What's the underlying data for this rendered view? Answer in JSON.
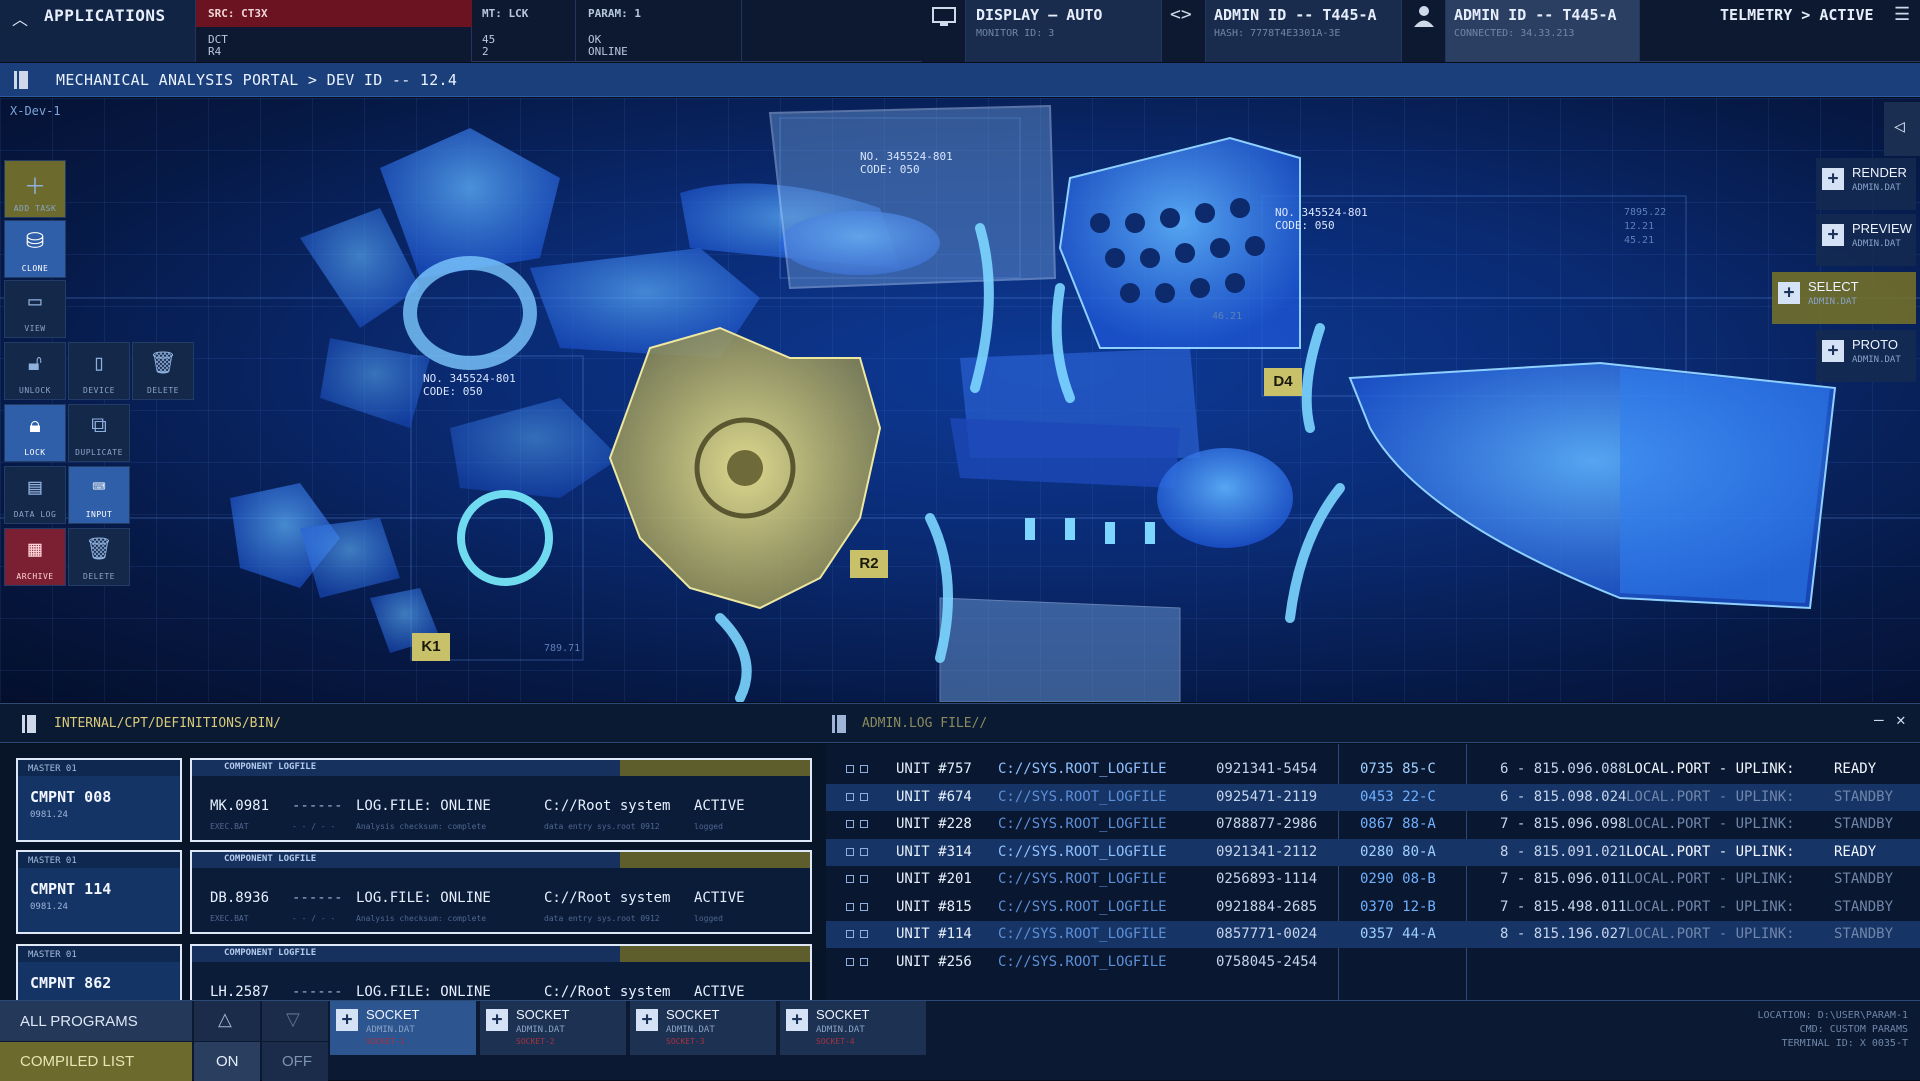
{
  "topbar": {
    "apps_label": "APPLICATIONS",
    "src": {
      "title": "SRC: CT3X",
      "line1": "DCT",
      "line2": "R4"
    },
    "mt": {
      "title": "MT: LCK",
      "line1": "45",
      "line2": "2"
    },
    "param": {
      "title": "PARAM: 1",
      "line1": "OK",
      "line2": "ONLINE"
    },
    "display": {
      "title": "DISPLAY – AUTO",
      "sub": "MONITOR ID: 3"
    },
    "admin1": {
      "title": "ADMIN ID -- T445-A",
      "sub": "HASH: 7778T4E3301A-3E"
    },
    "admin2": {
      "title": "ADMIN ID -- T445-A",
      "sub": "CONNECTED: 34.33.213"
    },
    "telemetry": "TELMETRY > ACTIVE"
  },
  "breadcrumb": "MECHANICAL ANALYSIS PORTAL > DEV ID -- 12.4",
  "viewport": {
    "device_label": "X-Dev-1",
    "annotations": [
      {
        "line1": "NO. 345524-801",
        "line2": "CODE: 050"
      },
      {
        "line1": "NO. 345524-801",
        "line2": "CODE: 050"
      },
      {
        "line1": "NO. 345524-801",
        "line2": "CODE: 050"
      }
    ],
    "tags": {
      "k1": "K1",
      "r2": "R2",
      "d4": "D4"
    },
    "small_nums": {
      "a": "789.71",
      "b": "7895.22",
      "c": "12.21",
      "d": "45.21",
      "e": "46.21"
    }
  },
  "toolbar": [
    {
      "label": "ADD TASK",
      "icon": "plus-icon"
    },
    {
      "label": "CLONE",
      "icon": "database-icon"
    },
    {
      "label": "VIEW",
      "icon": "monitor-icon"
    },
    {
      "label": "UNLOCK",
      "icon": "unlock-icon"
    },
    {
      "label": "DEVICE",
      "icon": "phone-icon"
    },
    {
      "label": "DELETE",
      "icon": "trash-icon"
    },
    {
      "label": "LOCK",
      "icon": "lock-icon"
    },
    {
      "label": "DUPLICATE",
      "icon": "duplicate-icon"
    },
    {
      "label": "DATA LOG",
      "icon": "archive-icon"
    },
    {
      "label": "INPUT",
      "icon": "keyboard-icon"
    },
    {
      "label": "ARCHIVE",
      "icon": "archive-box-icon"
    },
    {
      "label": "DELETE",
      "icon": "trash-icon"
    }
  ],
  "right_actions": [
    {
      "name": "RENDER",
      "sub": "ADMIN.DAT"
    },
    {
      "name": "PREVIEW",
      "sub": "ADMIN.DAT"
    },
    {
      "name": "SELECT",
      "sub": "ADMIN.DAT"
    },
    {
      "name": "PROTO",
      "sub": "ADMIN.DAT"
    }
  ],
  "left_panel": {
    "path": "INTERNAL/CPT/DEFINITIONS/BIN/",
    "components": [
      {
        "master": "MASTER 01",
        "name": "CMPNT 008",
        "date": "0981.24",
        "log_header": "COMPONENT LOGFILE",
        "code": "MK.0981",
        "dash": "------",
        "status": "LOG.FILE: ONLINE",
        "path": "C://Root system",
        "state": "ACTIVE",
        "s1": "EXEC.BAT",
        "s2": "- - / - -",
        "s3": "Analysis checksum: complete",
        "s4": "data entry sys.root 0912",
        "s5": "logged"
      },
      {
        "master": "MASTER 01",
        "name": "CMPNT 114",
        "date": "0981.24",
        "log_header": "COMPONENT LOGFILE",
        "code": "DB.8936",
        "dash": "------",
        "status": "LOG.FILE: ONLINE",
        "path": "C://Root system",
        "state": "ACTIVE",
        "s1": "EXEC.BAT",
        "s2": "- - / - -",
        "s3": "Analysis checksum: complete",
        "s4": "data entry sys.root 0912",
        "s5": "logged"
      },
      {
        "master": "MASTER 01",
        "name": "CMPNT 862",
        "date": "",
        "log_header": "COMPONENT LOGFILE",
        "code": "LH.2587",
        "dash": "------",
        "status": "LOG.FILE: ONLINE",
        "path": "C://Root system",
        "state": "ACTIVE",
        "s1": "",
        "s2": "",
        "s3": "",
        "s4": "",
        "s5": ""
      }
    ]
  },
  "right_panel": {
    "path": "ADMIN.LOG FILE//",
    "rows": [
      {
        "unit": "UNIT #757",
        "path": "C://SYS.ROOT_LOGFILE",
        "num": "0921341-5454",
        "code": "0735 85-C",
        "val": "6 - 815.096.088",
        "port": "LOCAL.PORT - UPLINK:",
        "status": "READY"
      },
      {
        "unit": "UNIT #674",
        "path": "C://SYS.ROOT_LOGFILE",
        "num": "0925471-2119",
        "code": "0453 22-C",
        "val": "6 - 815.098.024",
        "port": "LOCAL.PORT - UPLINK:",
        "status": "STANDBY"
      },
      {
        "unit": "UNIT #228",
        "path": "C://SYS.ROOT_LOGFILE",
        "num": "0788877-2986",
        "code": "0867 88-A",
        "val": "7 - 815.096.098",
        "port": "LOCAL.PORT - UPLINK:",
        "status": "STANDBY"
      },
      {
        "unit": "UNIT #314",
        "path": "C://SYS.ROOT_LOGFILE",
        "num": "0921341-2112",
        "code": "0280 80-A",
        "val": "8 - 815.091.021",
        "port": "LOCAL.PORT - UPLINK:",
        "status": "READY"
      },
      {
        "unit": "UNIT #201",
        "path": "C://SYS.ROOT_LOGFILE",
        "num": "0256893-1114",
        "code": "0290 08-B",
        "val": "7 - 815.096.011",
        "port": "LOCAL.PORT - UPLINK:",
        "status": "STANDBY"
      },
      {
        "unit": "UNIT #815",
        "path": "C://SYS.ROOT_LOGFILE",
        "num": "0921884-2685",
        "code": "0370 12-B",
        "val": "7 - 815.498.011",
        "port": "LOCAL.PORT - UPLINK:",
        "status": "STANDBY"
      },
      {
        "unit": "UNIT #114",
        "path": "C://SYS.ROOT_LOGFILE",
        "num": "0857771-0024",
        "code": "0357 44-A",
        "val": "8 - 815.196.027",
        "port": "LOCAL.PORT - UPLINK:",
        "status": "STANDBY"
      },
      {
        "unit": "UNIT #256",
        "path": "C://SYS.ROOT_LOGFILE",
        "num": "0758045-2454",
        "code": "",
        "val": "",
        "port": "",
        "status": ""
      }
    ]
  },
  "footer": {
    "all_programs": "ALL PROGRAMS",
    "compiled_list": "COMPILED LIST",
    "on": "ON",
    "off": "OFF",
    "sockets": [
      {
        "name": "SOCKET",
        "sub": "ADMIN.DAT",
        "red": "SOCKET-1"
      },
      {
        "name": "SOCKET",
        "sub": "ADMIN.DAT",
        "red": "SOCKET-2"
      },
      {
        "name": "SOCKET",
        "sub": "ADMIN.DAT",
        "red": "SOCKET-3"
      },
      {
        "name": "SOCKET",
        "sub": "ADMIN.DAT",
        "red": "SOCKET-4"
      }
    ],
    "location": "LOCATION: D:\\USER\\PARAM-1",
    "cmd": "CMD: CUSTOM PARAMS",
    "terminal": "TERMINAL ID: X 0035-T"
  },
  "colors": {
    "accent": "#2f5fa8",
    "alert": "#6b1320",
    "gold": "#c9c06a",
    "highlight": "#163566"
  }
}
